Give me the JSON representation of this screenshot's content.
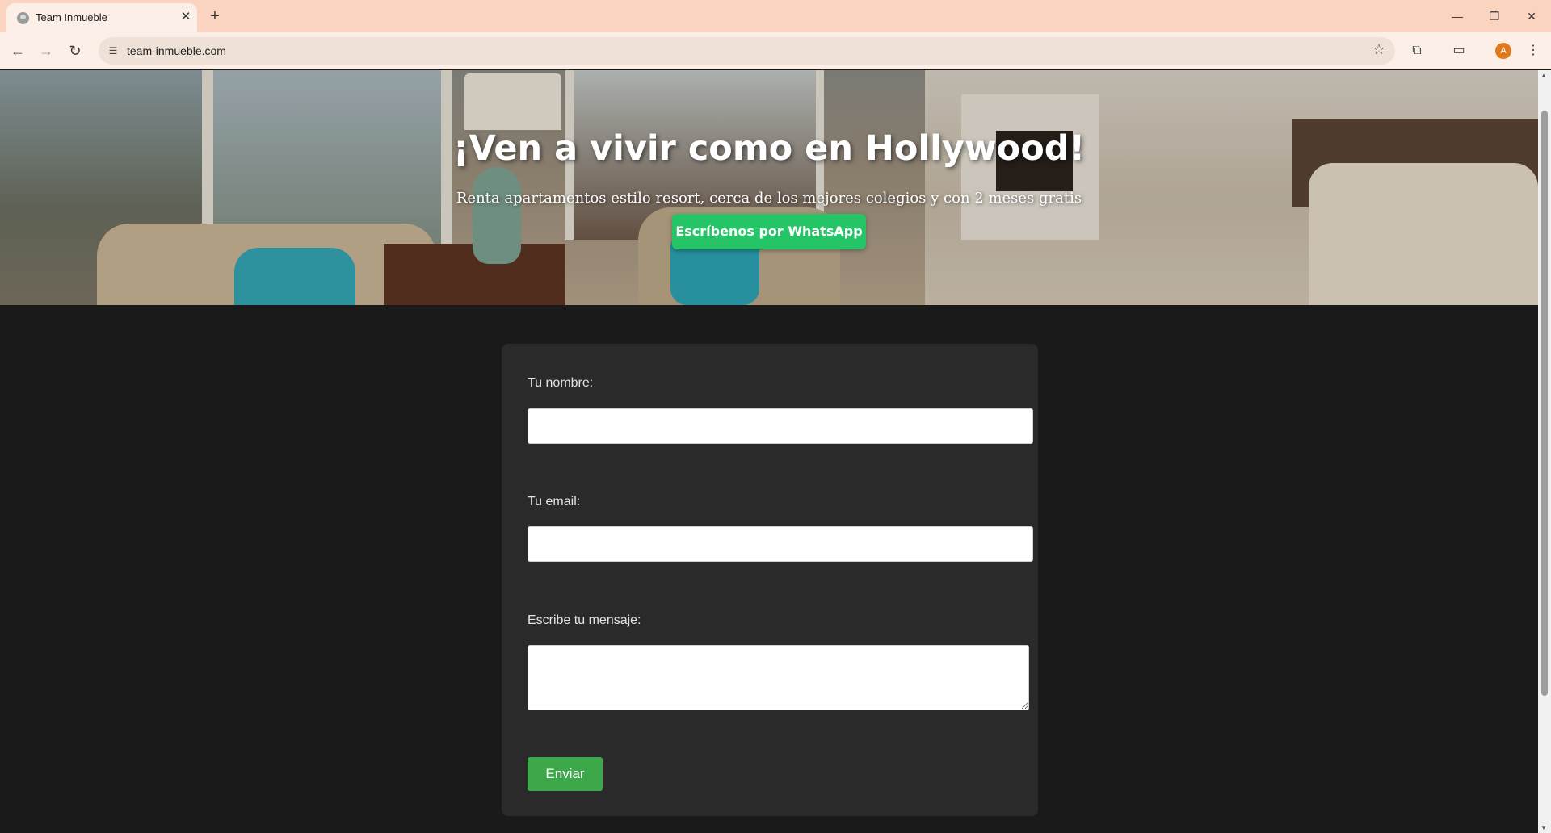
{
  "browser": {
    "tab_title": "Team Inmueble",
    "url": "team-inmueble.com",
    "avatar_letter": "A"
  },
  "hero": {
    "title": "¡Ven a vivir como en Hollywood!",
    "subtitle": "Renta apartamentos estilo resort, cerca de los mejores colegios y con 2 meses gratis",
    "cta_label": "Escríbenos por WhatsApp"
  },
  "form": {
    "name_label": "Tu nombre:",
    "name_value": "",
    "email_label": "Tu email:",
    "email_value": "",
    "message_label": "Escribe tu mensaje:",
    "message_value": "",
    "submit_label": "Enviar"
  },
  "colors": {
    "tabbar_bg": "#fad4bf",
    "page_bg": "#1a1a1a",
    "card_bg": "#2a2a2a",
    "whatsapp_green": "#25c466",
    "submit_green": "#3ca84a"
  }
}
